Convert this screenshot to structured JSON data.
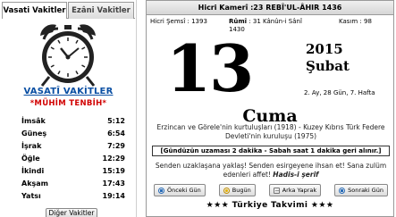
{
  "left_panel": {
    "tabs": [
      {
        "label": "Vasati Vakitler",
        "active": true
      },
      {
        "label": "Ezâni Vakitler",
        "active": false
      }
    ],
    "brand": "VASATÎ VAKİTLER",
    "notice": "*MÜHİM TENBİH*",
    "clock_icon": "alarm-clock-icon",
    "prayer_times": [
      {
        "name": "İmsâk",
        "time": "5:12"
      },
      {
        "name": "Güneş",
        "time": "6:54"
      },
      {
        "name": "İşrak",
        "time": "7:29"
      },
      {
        "name": "Öğle",
        "time": "12:29"
      },
      {
        "name": "İkindi",
        "time": "15:19"
      },
      {
        "name": "Akşam",
        "time": "17:43"
      },
      {
        "name": "Yatsı",
        "time": "19:14"
      }
    ],
    "other_button": "Diğer Vakitler"
  },
  "right_panel": {
    "hijri_header": "Hicri Kamerî :23 REBÎ'UL-ÂHIR 1436",
    "solar_label": "Hicri Şemsî",
    "solar_value": "1393",
    "rumi_label": "Rûmî",
    "rumi_value": "31 Kânûn-i Sânî 1430",
    "kasim_label": "Kasım",
    "kasim_value": "98",
    "day": "13",
    "year": "2015",
    "month": "Şubat",
    "week_info": "2. Ay, 28 Gün, 7. Hafta",
    "weekday": "Cuma",
    "event": "Erzincan ve Görele'nin kurtuluşları (1918) - Kuzey Kıbrıs Türk Federe Devleti'nin kuruluşu (1975)",
    "daylight": "[Gündüzün uzaması 2 dakika - Sabah saat 1 dakika geri alınır.]",
    "hadith_text": "Senden uzaklaşana yaklaş! Senden esirgeyene ihsan et! Sana zulüm edenleri affet!",
    "hadith_label": "Hadis-i şerif",
    "nav": {
      "prev": "Önceki Gün",
      "today": "Bugün",
      "back": "Arka Yaprak",
      "next": "Sonraki Gün"
    },
    "footer_title": "Türkiye Takvimi",
    "footer_star": "★★★"
  },
  "colors": {
    "brand": "#0a4fa3",
    "notice": "#d10000"
  }
}
